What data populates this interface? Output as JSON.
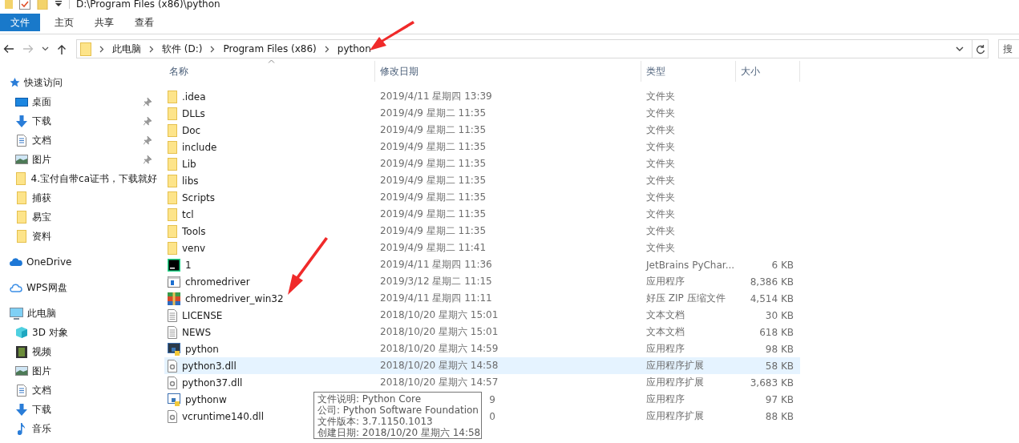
{
  "title_bar": {
    "path": "D:\\Program Files (x86)\\python"
  },
  "ribbon_tabs": [
    {
      "label": "文件",
      "selected": true
    },
    {
      "label": "主页",
      "selected": false
    },
    {
      "label": "共享",
      "selected": false
    },
    {
      "label": "查看",
      "selected": false
    }
  ],
  "address_bar": {
    "breadcrumbs": [
      "此电脑",
      "软件 (D:)",
      "Program Files (x86)",
      "python"
    ],
    "forward_disabled": true
  },
  "search": {
    "placeholder": "搜"
  },
  "sidebar": {
    "sections": [
      {
        "label": "快速访问",
        "kind": "star",
        "children": [
          {
            "label": "桌面",
            "kind": "desktop",
            "pinned": true
          },
          {
            "label": "下载",
            "kind": "download",
            "pinned": true
          },
          {
            "label": "文档",
            "kind": "document",
            "pinned": true
          },
          {
            "label": "图片",
            "kind": "image",
            "pinned": true
          },
          {
            "label": "4.宝付自带ca证书，下载就好",
            "kind": "folder",
            "pinned": false
          },
          {
            "label": "捕获",
            "kind": "folder",
            "pinned": false
          },
          {
            "label": "易宝",
            "kind": "folder",
            "pinned": false
          },
          {
            "label": "资料",
            "kind": "folder",
            "pinned": false
          }
        ]
      },
      {
        "label": "OneDrive",
        "kind": "cloud"
      },
      {
        "label": "WPS网盘",
        "kind": "cloud-outline"
      },
      {
        "label": "此电脑",
        "kind": "computer",
        "children": [
          {
            "label": "3D 对象",
            "kind": "cube",
            "pinned": false
          },
          {
            "label": "视频",
            "kind": "film",
            "pinned": false
          },
          {
            "label": "图片",
            "kind": "image",
            "pinned": false
          },
          {
            "label": "文档",
            "kind": "document",
            "pinned": false
          },
          {
            "label": "下载",
            "kind": "download",
            "pinned": false
          },
          {
            "label": "音乐",
            "kind": "music",
            "pinned": false
          }
        ]
      }
    ]
  },
  "table": {
    "columns": [
      "名称",
      "修改日期",
      "类型",
      "大小"
    ],
    "rows": [
      {
        "kind": "folder",
        "name": ".idea",
        "date": "2019/4/11 星期四 13:39",
        "type": "文件夹",
        "size": "",
        "selected": false,
        "date_covered": false
      },
      {
        "kind": "folder",
        "name": "DLLs",
        "date": "2019/4/9 星期二 11:35",
        "type": "文件夹",
        "size": "",
        "selected": false,
        "date_covered": false
      },
      {
        "kind": "folder",
        "name": "Doc",
        "date": "2019/4/9 星期二 11:35",
        "type": "文件夹",
        "size": "",
        "selected": false,
        "date_covered": false
      },
      {
        "kind": "folder",
        "name": "include",
        "date": "2019/4/9 星期二 11:35",
        "type": "文件夹",
        "size": "",
        "selected": false,
        "date_covered": false
      },
      {
        "kind": "folder",
        "name": "Lib",
        "date": "2019/4/9 星期二 11:35",
        "type": "文件夹",
        "size": "",
        "selected": false,
        "date_covered": false
      },
      {
        "kind": "folder",
        "name": "libs",
        "date": "2019/4/9 星期二 11:35",
        "type": "文件夹",
        "size": "",
        "selected": false,
        "date_covered": false
      },
      {
        "kind": "folder",
        "name": "Scripts",
        "date": "2019/4/9 星期二 11:35",
        "type": "文件夹",
        "size": "",
        "selected": false,
        "date_covered": false
      },
      {
        "kind": "folder",
        "name": "tcl",
        "date": "2019/4/9 星期二 11:35",
        "type": "文件夹",
        "size": "",
        "selected": false,
        "date_covered": false
      },
      {
        "kind": "folder",
        "name": "Tools",
        "date": "2019/4/9 星期二 11:35",
        "type": "文件夹",
        "size": "",
        "selected": false,
        "date_covered": false
      },
      {
        "kind": "folder",
        "name": "venv",
        "date": "2019/4/9 星期二 11:41",
        "type": "文件夹",
        "size": "",
        "selected": false,
        "date_covered": false
      },
      {
        "kind": "pycharm",
        "name": "1",
        "date": "2019/4/11 星期四 11:36",
        "type": "JetBrains PyChar...",
        "size": "6 KB",
        "selected": false,
        "date_covered": false
      },
      {
        "kind": "app",
        "name": "chromedriver",
        "date": "2019/3/12 星期二 11:15",
        "type": "应用程序",
        "size": "8,386 KB",
        "selected": false,
        "date_covered": false
      },
      {
        "kind": "zip",
        "name": "chromedriver_win32",
        "date": "2019/4/11 星期四 11:11",
        "type": "好压 ZIP 压缩文件",
        "size": "4,514 KB",
        "selected": false,
        "date_covered": false
      },
      {
        "kind": "text",
        "name": "LICENSE",
        "date": "2018/10/20 星期六 15:01",
        "type": "文本文档",
        "size": "30 KB",
        "selected": false,
        "date_covered": false
      },
      {
        "kind": "text",
        "name": "NEWS",
        "date": "2018/10/20 星期六 15:01",
        "type": "文本文档",
        "size": "618 KB",
        "selected": false,
        "date_covered": false
      },
      {
        "kind": "python",
        "name": "python",
        "date": "2018/10/20 星期六 14:59",
        "type": "应用程序",
        "size": "98 KB",
        "selected": false,
        "date_covered": false
      },
      {
        "kind": "dll",
        "name": "python3.dll",
        "date": "2018/10/20 星期六 14:58",
        "type": "应用程序扩展",
        "size": "58 KB",
        "selected": true,
        "date_covered": false
      },
      {
        "kind": "dll",
        "name": "python37.dll",
        "date": "2018/10/20 星期六 14:57",
        "type": "应用程序扩展",
        "size": "3,683 KB",
        "selected": false,
        "date_covered": false
      },
      {
        "kind": "pythonw",
        "name": "pythonw",
        "date": "9",
        "type": "应用程序",
        "size": "97 KB",
        "selected": false,
        "date_covered": true
      },
      {
        "kind": "dll",
        "name": "vcruntime140.dll",
        "date": "0",
        "type": "应用程序扩展",
        "size": "88 KB",
        "selected": false,
        "date_covered": true
      }
    ]
  },
  "tooltip": {
    "lines": [
      "文件说明: Python Core",
      "公司: Python Software Foundation",
      "文件版本: 3.7.1150.1013",
      "创建日期: 2018/10/20 星期六 14:58"
    ]
  }
}
